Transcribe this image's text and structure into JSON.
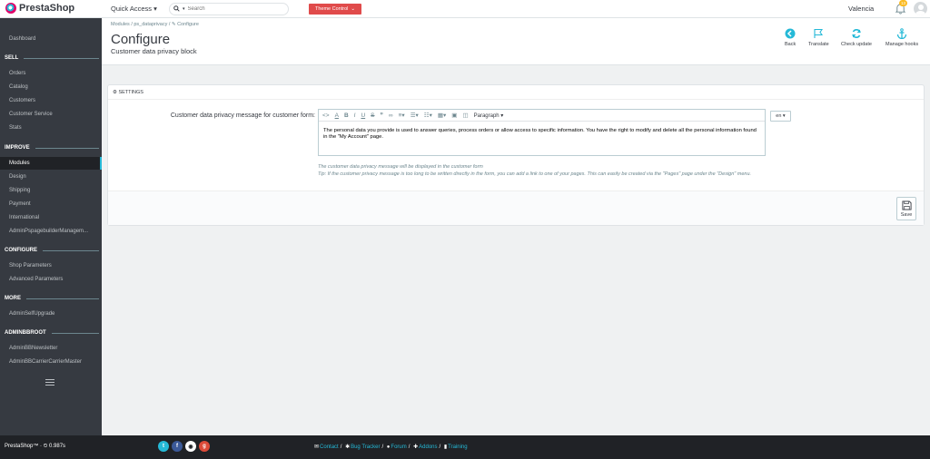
{
  "app": {
    "logo_text": "PrestaShop"
  },
  "header": {
    "quick_access": "Quick Access ▾",
    "search_placeholder": "Search",
    "theme_control": "Theme Control",
    "shop_name": "Valencia",
    "notification_count": "13"
  },
  "sidebar": {
    "dashboard": "Dashboard",
    "sell": "SELL",
    "orders": "Orders",
    "catalog": "Catalog",
    "customers": "Customers",
    "customer_service": "Customer Service",
    "stats": "Stats",
    "improve": "IMPROVE",
    "modules": "Modules",
    "design": "Design",
    "shipping": "Shipping",
    "payment": "Payment",
    "international": "International",
    "pagebuilder": "AdminPspagebuilderManagem...",
    "configure": "CONFIGURE",
    "shop_parameters": "Shop Parameters",
    "advanced_parameters": "Advanced Parameters",
    "more": "MORE",
    "self_upgrade": "AdminSelfUpgrade",
    "adminbbroot": "ADMINBBROOT",
    "newsletter": "AdminBBNewsletter",
    "carrier_master": "AdminBBCarrierCarrierMaster"
  },
  "page": {
    "breadcrumb": "Modules  /  ps_dataprivacy  /  ✎ Configure",
    "title": "Configure",
    "subtitle": "Customer data privacy block"
  },
  "toolbar": {
    "back": "Back",
    "translate": "Translate",
    "check_update": "Check update",
    "manage_hooks": "Manage hooks"
  },
  "settings": {
    "heading": "SETTINGS",
    "field_label": "Customer data privacy message for customer form:",
    "paragraph_select": "Paragraph ▾",
    "message": "The personal data you provide is used to answer queries, process orders or allow access to specific information. You have the right to modify and delete all the personal information found in the \"My Account\" page.",
    "lang": "en ▾",
    "help_1": "The customer data privacy message will be displayed in the customer form",
    "help_2": "Tip: If the customer privacy message is too long to be written directly in the form, you can add a link to one of your pages. This can easily be created via the \"Pages\" page under the \"Design\" menu.",
    "save": "Save"
  },
  "footer": {
    "version": "PrestaShop™ · ⏲ 0.987s",
    "contact": "Contact",
    "bug_tracker": "Bug Tracker",
    "forum": "Forum",
    "addons": "Addons",
    "training": "Training"
  },
  "colors": {
    "accent": "#25b9d7",
    "sidebar": "#363a41",
    "theme_button": "#e04b4b"
  }
}
